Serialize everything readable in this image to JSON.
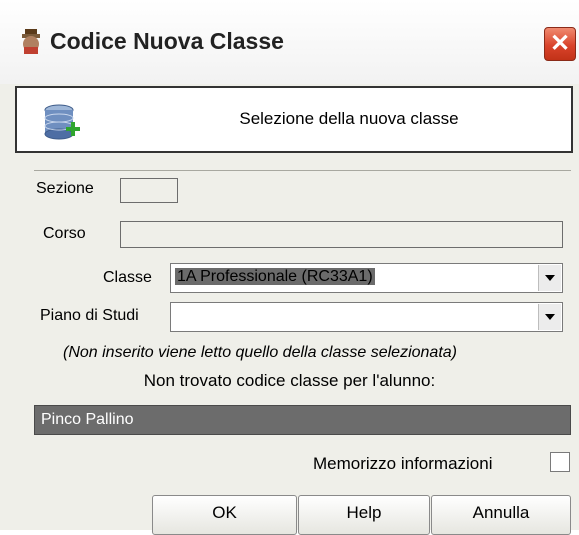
{
  "window": {
    "title": "Codice Nuova Classe",
    "close_symbol": "✕"
  },
  "header": {
    "text": "Selezione della nuova classe"
  },
  "form": {
    "sezione_label": "Sezione",
    "sezione_value": "",
    "corso_label": "Corso",
    "corso_value": "",
    "classe_label": "Classe",
    "classe_value": "1A Professionale (RC33A1)",
    "piano_label": "Piano di Studi",
    "piano_value": ""
  },
  "note": "(Non inserito viene letto quello della classe selezionata)",
  "not_found": "Non trovato codice classe per l'alunno:",
  "student": "Pinco Pallino",
  "memorize_label": "Memorizzo informazioni",
  "memorize_checked": false,
  "buttons": {
    "ok": "OK",
    "help": "Help",
    "cancel": "Annulla"
  }
}
